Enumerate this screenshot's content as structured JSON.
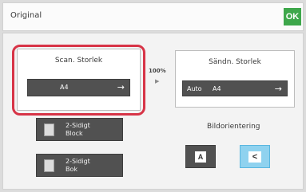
{
  "header": {
    "title": "Original",
    "ok_label": "OK"
  },
  "scan_size": {
    "title": "Scan. Storlek",
    "value": "A4",
    "arrow": "→"
  },
  "ratio": {
    "percent": "100%",
    "arrow": "▶"
  },
  "send_size": {
    "title": "Sändn. Storlek",
    "auto_label": "Auto",
    "value": "A4",
    "arrow": "→"
  },
  "duplex": {
    "block_label": "2-Sidigt\nBlock",
    "book_label": "2-Sidigt\nBok"
  },
  "orientation": {
    "label": "Bildorientering",
    "portrait_glyph": "A",
    "landscape_glyph": "<"
  },
  "colors": {
    "ok_green": "#3ea74b",
    "highlight_red": "#d73447",
    "selected_blue": "#8fd2ef",
    "button_dark": "#515151"
  }
}
